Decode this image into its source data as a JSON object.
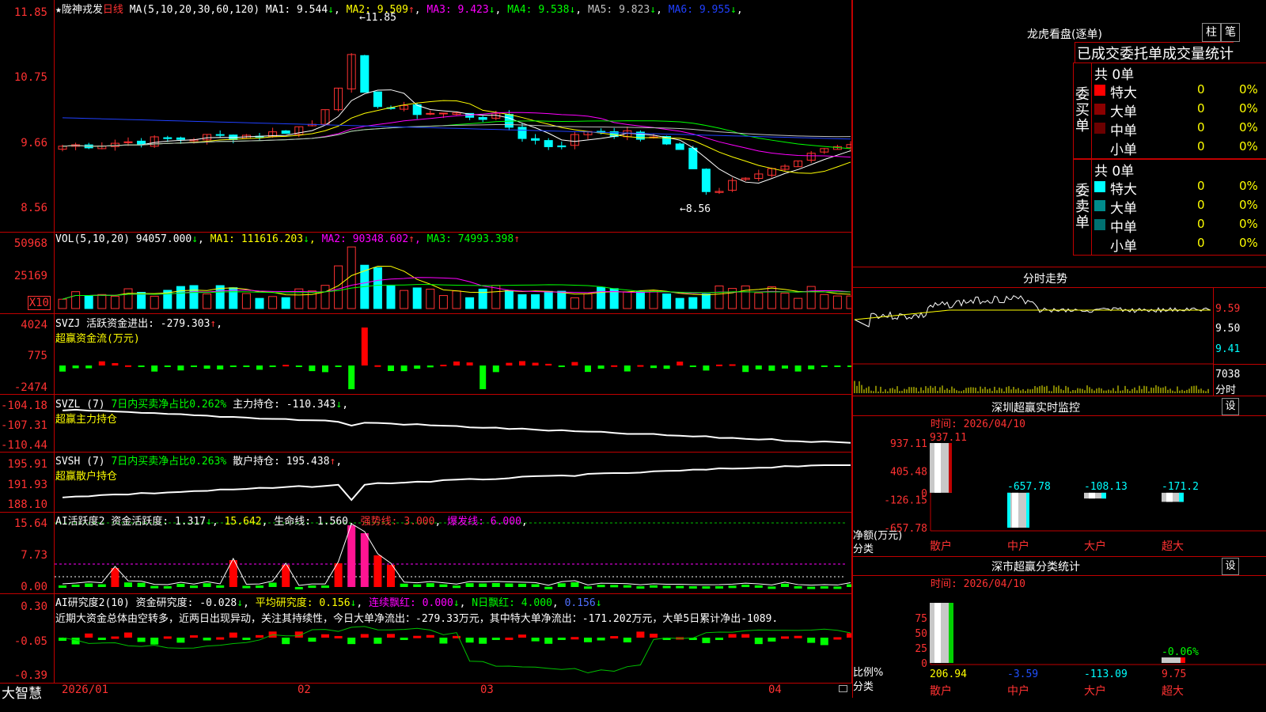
{
  "main_chart": {
    "stock_name": "陇神戎发",
    "period": "日线",
    "ma_label": "MA(5,10,20,30,60,120)",
    "ma": [
      {
        "name": "MA1:",
        "value": "9.544",
        "arrow": "↓",
        "color": "#ffffff"
      },
      {
        "name": "MA2:",
        "value": "9.509",
        "arrow": "↑",
        "color": "#ffff00"
      },
      {
        "name": "MA3:",
        "value": "9.423",
        "arrow": "↓",
        "color": "#ff00ff"
      },
      {
        "name": "MA4:",
        "value": "9.538",
        "arrow": "↓",
        "color": "#00ff00"
      },
      {
        "name": "MA5:",
        "value": "9.823",
        "arrow": "↓",
        "color": "#c0c0c0"
      },
      {
        "name": "MA6:",
        "value": "9.955",
        "arrow": "↓",
        "color": "#2040ff"
      }
    ],
    "y_ticks": [
      "11.85",
      "10.75",
      "9.66",
      "8.56"
    ],
    "high_label": "11.85",
    "low_label": "8.56"
  },
  "vol_chart": {
    "label": "VOL(5,10,20)",
    "vol": "94057.000",
    "vol_arrow": "↓",
    "ma1": "MA1: 111616.203",
    "ma1_arrow": "↓",
    "ma2": "MA2: 90348.602",
    "ma2_arrow": "↑",
    "ma3": "MA3: 74993.398",
    "ma3_arrow": "↑",
    "y_ticks": [
      "50968",
      "25169"
    ],
    "unit": "X10"
  },
  "svzj": {
    "label": "SVZJ  活跃资金进出: -279.303",
    "arrow": "↑",
    "sub": "超赢资金流(万元)",
    "y_ticks": [
      "4024",
      "775",
      "-2474"
    ]
  },
  "svzl": {
    "label": "SVZL (7)",
    "pct": "7日内买卖净占比0.262%",
    "hold": "主力持仓: -110.343",
    "arrow": "↓",
    "sub": "超赢主力持仓",
    "y_ticks": [
      "-104.18",
      "-107.31",
      "-110.44"
    ]
  },
  "svsh": {
    "label": "SVSH (7)",
    "pct": "7日内买卖净占比0.263%",
    "hold": "散户持仓: 195.438",
    "arrow": "↑",
    "sub": "超赢散户持仓",
    "y_ticks": [
      "195.91",
      "191.93",
      "188.10"
    ]
  },
  "ai_act": {
    "label": "AI活跃度2",
    "val1": "资金活跃度: 1.317",
    "val1_arrow": "↓",
    "val2": "15.642",
    "val3": "生命线: 1.560",
    "val4": "强势线: 3.000",
    "val5": "爆发线: 6.000",
    "y_ticks": [
      "15.64",
      "7.73",
      "0.00"
    ]
  },
  "ai_res": {
    "label": "AI研究度2(10)",
    "val1": "资金研究度: -0.028",
    "val1_arrow": "↓",
    "val2": "平均研究度: 0.156",
    "val2_arrow": "↓",
    "val3": "连续飘红: 0.000",
    "val3_arrow": "↓",
    "val4": "N日飘红: 4.000",
    "val5": "0.156",
    "val5_arrow": "↓",
    "comment": "近期大资金总体由空转多，近两日出现异动，关注其持续性，今日大单净流出：-279.33万元，其中特大单净流出：-171.202万元，大单5日累计净出-1089.",
    "y_ticks": [
      "0.30",
      "-0.05",
      "-0.39"
    ]
  },
  "bottom": {
    "brand": "大智慧",
    "dates": [
      "2026/01",
      "02",
      "03",
      "04"
    ]
  },
  "longhu": {
    "title": "龙虎看盘(逐单)",
    "btn_zhu": "柱",
    "btn_bi": "笔",
    "stats_title": "已成交委托单成交量统计",
    "buy_side": "委买单",
    "sell_side": "委卖单",
    "buy_total": "共 0单",
    "sell_total": "共 0单",
    "rows": [
      {
        "label": "特大",
        "count": "0",
        "pct": "0%"
      },
      {
        "label": "大单",
        "count": "0",
        "pct": "0%"
      },
      {
        "label": "中单",
        "count": "0",
        "pct": "0%"
      },
      {
        "label": "小单",
        "count": "0",
        "pct": "0%"
      }
    ],
    "buy_colors": [
      "#ff0000",
      "#8b0000",
      "#6b0000",
      ""
    ],
    "sell_colors": [
      "#00ffff",
      "#008b8b",
      "#007070",
      ""
    ]
  },
  "intraday": {
    "title": "分时走势",
    "y_ticks": [
      "9.59",
      "9.50",
      "9.41"
    ],
    "vol_tick": "7038",
    "vol_unit": "分时"
  },
  "monitor": {
    "title": "深圳超赢实时监控",
    "btn": "设",
    "time": "时间: 2026/04/10",
    "y_ticks": [
      "937.11",
      "405.48",
      "0",
      "-126.15",
      "-657.78"
    ],
    "y_label": "净额(万元)",
    "x_label": "分类",
    "categories": [
      "散户",
      "中户",
      "大户",
      "超大"
    ],
    "values": [
      "937.11",
      "-657.78",
      "-108.13",
      "-171.2"
    ]
  },
  "classify": {
    "title": "深市超赢分类统计",
    "btn": "设",
    "time": "时间: 2026/04/10",
    "y_ticks": [
      "75",
      "50",
      "25",
      "0"
    ],
    "y_label": "比例%",
    "x_label": "分类",
    "categories": [
      "散户",
      "中户",
      "大户",
      "超大"
    ],
    "values": [
      "206.94",
      "-3.59",
      "-113.09",
      "9.75"
    ],
    "extra": "-0.06%"
  }
}
